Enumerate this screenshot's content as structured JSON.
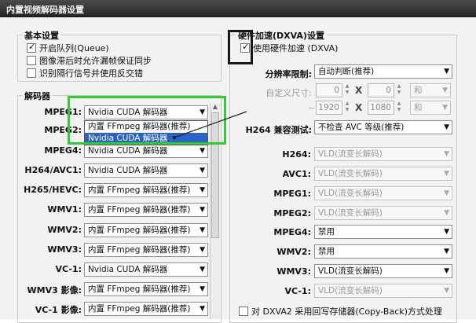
{
  "window": {
    "title": "内置视频解码器设置"
  },
  "basic": {
    "title": "基本设置",
    "options": [
      {
        "label": "开启队列(Queue)",
        "checked": true
      },
      {
        "label": "图像滞后时允许漏帧保证同步",
        "checked": false
      },
      {
        "label": "识别隔行信号并使用反交错",
        "checked": false
      }
    ]
  },
  "decoders": {
    "title": "解码器",
    "rows": [
      {
        "label": "MPEG1:",
        "value": "Nvidia CUDA 解码器"
      },
      {
        "label": "MPEG2:",
        "value": ""
      },
      {
        "label": "MPEG4:",
        "value": "Nvidia CUDA 解码器"
      },
      {
        "label": "H264/AVC1:",
        "value": "Nvidia CUDA 解码器"
      },
      {
        "label": "H265/HEVC:",
        "value": "内置 FFmpeg 解码器(推荐)"
      },
      {
        "label": "WMV1:",
        "value": "内置 FFmpeg 解码器(推荐)"
      },
      {
        "label": "WMV2:",
        "value": "内置 FFmpeg 解码器(推荐)"
      },
      {
        "label": "WMV3:",
        "value": "内置 FFmpeg 解码器(推荐)"
      },
      {
        "label": "VC-1:",
        "value": "Nvidia CUDA 解码器"
      },
      {
        "label": "WMV3 影像:",
        "value": "内置 FFmpeg 解码器(推荐)"
      },
      {
        "label": "VC-1 影像:",
        "value": "内置 FFmpeg 解码器(推荐)"
      }
    ],
    "dropdown_options": [
      "内置 FFmpeg 解码器(推荐)",
      "Nvidia CUDA 解码器"
    ]
  },
  "hw": {
    "title": "硬件加速(DXVA)设置",
    "enable_label": "使用硬件加速 (DXVA)",
    "enable_checked": true,
    "resolution_limit_label": "分辨率限制:",
    "resolution_limit_value": "自动判断(推荐)",
    "custom_size_label": "自定义尺寸:",
    "size_row1": {
      "w": "0",
      "x": "X",
      "h": "0",
      "op": "和"
    },
    "size_row2": {
      "tilde": "~",
      "w": "1920",
      "x": "X",
      "h": "1080",
      "op": "和"
    },
    "h264_compat_label": "H264 兼容测试:",
    "h264_compat_value": "不检查 AVC 等级(推荐)",
    "codecs": [
      {
        "label": "H264:",
        "value": "VLD(流变长解码)",
        "enabled": false
      },
      {
        "label": "AVC1:",
        "value": "VLD(流变长解码)",
        "enabled": false
      },
      {
        "label": "MPEG1:",
        "value": "VLD(流变长解码)",
        "enabled": false
      },
      {
        "label": "MPEG2:",
        "value": "VLD(流变长解码)",
        "enabled": false
      },
      {
        "label": "MPEG4:",
        "value": "禁用",
        "enabled": true
      },
      {
        "label": "WMV2:",
        "value": "禁用",
        "enabled": true
      },
      {
        "label": "WMV3:",
        "value": "VLD(流变长解码)",
        "enabled": true
      },
      {
        "label": "VC-1:",
        "value": "VLD(流变长解码)",
        "enabled": false
      }
    ],
    "copyback_label": "对 DXVA2 采用回写存储器(Copy-Back)方式处理",
    "copyback_checked": false
  },
  "colors": {
    "highlight_green": "#37c837",
    "highlight_dark": "#101820",
    "selection_blue": "#2c62c4"
  }
}
